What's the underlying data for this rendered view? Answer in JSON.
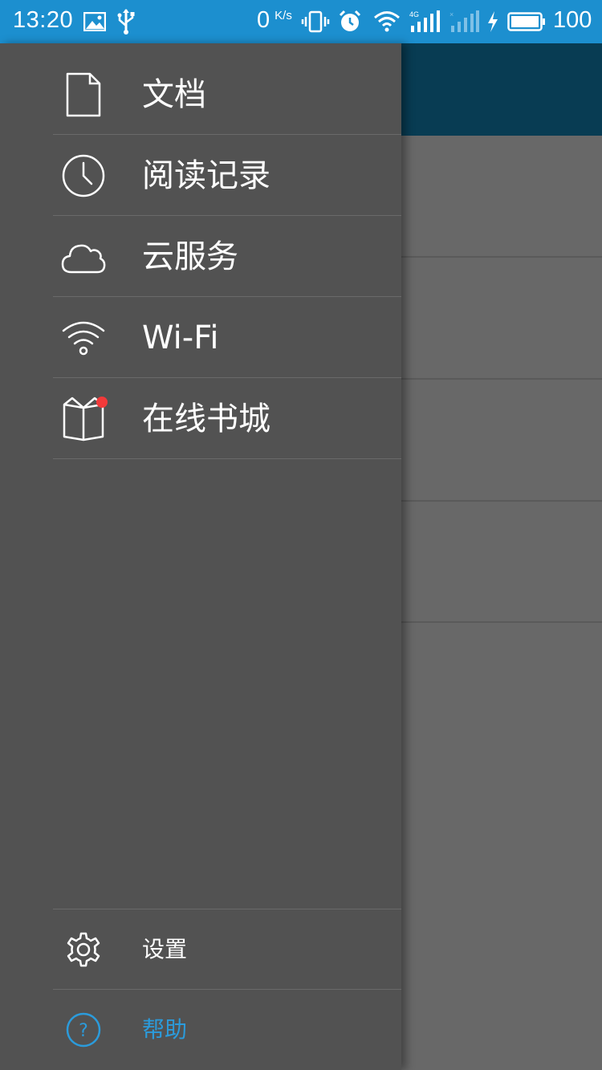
{
  "status_bar": {
    "time": "13:20",
    "net_speed_value": "0",
    "net_speed_unit": "K/s",
    "battery_level": "100",
    "background_color": "#1C8FCF",
    "icons": [
      "image-icon",
      "usb-icon",
      "vibrate-icon",
      "alarm-icon",
      "wifi-icon",
      "signal-4g-icon",
      "signal-no-sim-icon",
      "charging-icon",
      "battery-icon"
    ]
  },
  "drawer": {
    "items": [
      {
        "label": "文档",
        "icon": "document-icon"
      },
      {
        "label": "阅读记录",
        "icon": "clock-icon"
      },
      {
        "label": "云服务",
        "icon": "cloud-icon"
      },
      {
        "label": "Wi-Fi",
        "icon": "wifi-icon"
      },
      {
        "label": "在线书城",
        "icon": "open-book-icon",
        "badge": true
      }
    ],
    "bottom_items": [
      {
        "label": "设置",
        "icon": "gear-icon"
      },
      {
        "label": "帮助",
        "icon": "help-circle-icon"
      }
    ],
    "colors": {
      "background": "#525252",
      "text": "#FFFFFF",
      "accent": "#2B9BDB",
      "badge": "#F23A3A"
    }
  },
  "main": {
    "toolbar_color": "#083C53",
    "list_background": "#686868"
  }
}
